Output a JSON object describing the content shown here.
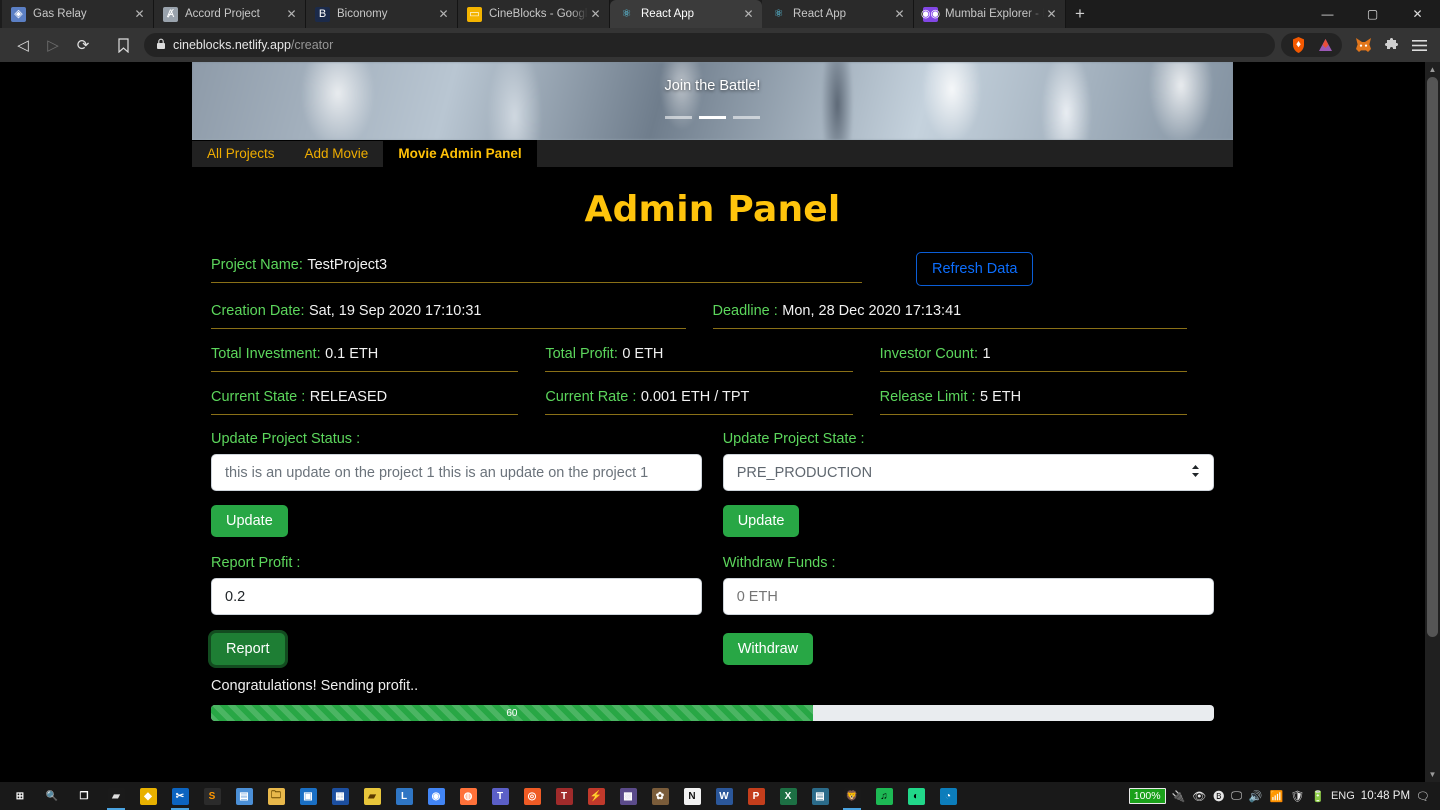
{
  "browser": {
    "tabs": [
      {
        "title": "Gas Relay",
        "icon": "ethereum-gas-icon",
        "glyph": "◈",
        "color": "#5b7fc4",
        "active": false
      },
      {
        "title": "Accord Project",
        "icon": "accord-icon",
        "glyph": "Ⱥ",
        "color": "#9aa3ad",
        "active": false
      },
      {
        "title": "Biconomy",
        "icon": "biconomy-icon",
        "glyph": "B",
        "color": "#1b2a4a",
        "active": false
      },
      {
        "title": "CineBlocks - Google Slid",
        "icon": "google-slides-icon",
        "glyph": "▭",
        "color": "#f4b400",
        "active": false
      },
      {
        "title": "React App",
        "icon": "react-icon",
        "glyph": "⚛",
        "color": "#61dafb",
        "active": true
      },
      {
        "title": "React App",
        "icon": "react-icon",
        "glyph": "⚛",
        "color": "#61dafb",
        "active": false
      },
      {
        "title": "Mumbai Explorer - Block",
        "icon": "polygon-explorer-icon",
        "glyph": "◉◉",
        "color": "#8247e5",
        "active": false
      }
    ],
    "close_label": "✕",
    "new_tab_label": "+",
    "window_controls": {
      "minimize": "—",
      "maximize": "▢",
      "close": "✕"
    },
    "nav": {
      "back": "◁",
      "forward": "▷",
      "reload": "⟳",
      "bookmark": "🔖"
    },
    "url": {
      "lock": "🔒",
      "host": "cineblocks.netlify.app",
      "path": "/creator"
    },
    "right_icons": [
      {
        "name": "brave-shields-icon",
        "glyph": "🦁"
      },
      {
        "name": "brave-rewards-icon",
        "glyph": "🔺"
      },
      {
        "name": "metamask-extension-icon",
        "glyph": "🦊"
      },
      {
        "name": "extensions-icon",
        "glyph": "🧩"
      },
      {
        "name": "browser-menu-icon",
        "glyph": "☰"
      }
    ]
  },
  "carousel": {
    "caption": "Join the Battle!",
    "slides": 3,
    "active_slide": 2
  },
  "nav_tabs": [
    {
      "label": "All Projects",
      "active": false
    },
    {
      "label": "Add Movie",
      "active": false
    },
    {
      "label": "Movie Admin Panel",
      "active": true
    }
  ],
  "panel": {
    "title": "Admin Panel",
    "refresh_button": "Refresh Data",
    "info": {
      "project_name": {
        "label": "Project Name:",
        "value": "TestProject3"
      },
      "creation_date": {
        "label": "Creation Date:",
        "value": "Sat, 19 Sep 2020 17:10:31"
      },
      "deadline": {
        "label": "Deadline :",
        "value": "Mon, 28 Dec 2020 17:13:41"
      },
      "total_investment": {
        "label": "Total Investment:",
        "value": "0.1 ETH"
      },
      "total_profit": {
        "label": "Total Profit:",
        "value": "0 ETH"
      },
      "investor_count": {
        "label": "Investor Count:",
        "value": "1"
      },
      "current_state": {
        "label": "Current State :",
        "value": "RELEASED"
      },
      "current_rate": {
        "label": "Current Rate :",
        "value": "0.001 ETH / TPT"
      },
      "release_limit": {
        "label": "Release Limit :",
        "value": "5 ETH"
      }
    },
    "forms": {
      "update_status": {
        "label": "Update Project Status :",
        "value": "this is an update on the project 1 this is an update on the project 1",
        "placeholder": "this is an update on the project 1 this is an update on the project 1",
        "button": "Update"
      },
      "update_state": {
        "label": "Update Project State :",
        "selected": "PRE_PRODUCTION",
        "button": "Update",
        "chevron": "⇕"
      },
      "report_profit": {
        "label": "Report Profit :",
        "value": "0.2",
        "placeholder": "0.2",
        "button": "Report"
      },
      "withdraw_funds": {
        "label": "Withdraw Funds :",
        "value": "",
        "placeholder": "0 ETH",
        "button": "Withdraw"
      }
    },
    "status_message": "Congratulations! Sending profit..",
    "progress": {
      "percent": 60,
      "label": "60"
    }
  },
  "colors": {
    "accent_gold": "#ffc40c",
    "label_green": "#5cd65c",
    "button_green": "#28a745",
    "link_blue": "#0d6efd",
    "underline": "#8a7017"
  },
  "taskbar": {
    "items": [
      {
        "name": "start-button",
        "glyph": "⊞",
        "color": "transparent",
        "text": "#fff",
        "running": false
      },
      {
        "name": "search-icon",
        "glyph": "🔍",
        "color": "transparent",
        "text": "#fff",
        "running": false
      },
      {
        "name": "task-view-icon",
        "glyph": "❐",
        "color": "transparent",
        "text": "#fff",
        "running": false
      },
      {
        "name": "terminal-icon",
        "glyph": "▰",
        "color": "#1a1a1a",
        "text": "#ddd",
        "running": true
      },
      {
        "name": "paint-net-icon",
        "glyph": "◆",
        "color": "#e8b100",
        "text": "#fff",
        "running": false
      },
      {
        "name": "vscode-icon",
        "glyph": "✂",
        "color": "#0c64c0",
        "text": "#fff",
        "running": true
      },
      {
        "name": "sublime-text-icon",
        "glyph": "S",
        "color": "#2b2b2b",
        "text": "#ff9800",
        "running": false
      },
      {
        "name": "notes-icon",
        "glyph": "▤",
        "color": "#4b8fd6",
        "text": "#fff",
        "running": false
      },
      {
        "name": "file-explorer-icon",
        "glyph": "🗀",
        "color": "#e8b84b",
        "text": "#6b4b00",
        "running": false
      },
      {
        "name": "outlook-icon",
        "glyph": "▣",
        "color": "#1a6fc4",
        "text": "#fff",
        "running": false
      },
      {
        "name": "devtools-icon",
        "glyph": "▦",
        "color": "#1c4fa0",
        "text": "#fff",
        "running": false
      },
      {
        "name": "pdf-reader-icon",
        "glyph": "▰",
        "color": "#e8c63b",
        "text": "#5a3a00",
        "running": false
      },
      {
        "name": "lastpass-icon",
        "glyph": "L",
        "color": "#2f76c4",
        "text": "#fff",
        "running": false
      },
      {
        "name": "chrome-icon",
        "glyph": "◉",
        "color": "#4285f4",
        "text": "#fff",
        "running": false
      },
      {
        "name": "firefox-icon",
        "glyph": "◍",
        "color": "#ff7139",
        "text": "#fff",
        "running": false
      },
      {
        "name": "teams-icon",
        "glyph": "T",
        "color": "#5b5fc7",
        "text": "#fff",
        "running": false
      },
      {
        "name": "postman-icon",
        "glyph": "◎",
        "color": "#ef5b25",
        "text": "#fff",
        "running": false
      },
      {
        "name": "truffle-icon",
        "glyph": "T",
        "color": "#a02b2b",
        "text": "#fff",
        "running": false
      },
      {
        "name": "remix-icon",
        "glyph": "⚡",
        "color": "#c0392b",
        "text": "#fff",
        "running": false
      },
      {
        "name": "ganache-icon",
        "glyph": "▩",
        "color": "#5b4b8a",
        "text": "#fff",
        "running": false
      },
      {
        "name": "gimp-icon",
        "glyph": "✿",
        "color": "#7a5c3a",
        "text": "#fff",
        "running": false
      },
      {
        "name": "notion-icon",
        "glyph": "N",
        "color": "#f2f2f2",
        "text": "#111",
        "running": false
      },
      {
        "name": "word-icon",
        "glyph": "W",
        "color": "#2b579a",
        "text": "#fff",
        "running": false
      },
      {
        "name": "powerpoint-icon",
        "glyph": "P",
        "color": "#c43e1c",
        "text": "#fff",
        "running": false
      },
      {
        "name": "excel-icon",
        "glyph": "X",
        "color": "#1d7044",
        "text": "#fff",
        "running": false
      },
      {
        "name": "mysql-icon",
        "glyph": "▤",
        "color": "#2b6b8a",
        "text": "#fff",
        "running": false
      },
      {
        "name": "brave-browser-icon",
        "glyph": "🦁",
        "color": "#1a1a1a",
        "text": "#f35800",
        "running": true
      },
      {
        "name": "spotify-icon",
        "glyph": "♫",
        "color": "#1db954",
        "text": "#000",
        "running": false
      },
      {
        "name": "pycharm-icon",
        "glyph": "◐",
        "color": "#21d789",
        "text": "#000",
        "running": false
      },
      {
        "name": "edge-icon",
        "glyph": "◔",
        "color": "#0c7dbb",
        "text": "#fff",
        "running": false
      }
    ],
    "tray": {
      "battery_percent": "100%",
      "icons": [
        {
          "name": "power-plug-icon",
          "glyph": "🔌"
        },
        {
          "name": "nvidia-icon",
          "glyph": "👁"
        },
        {
          "name": "bluetooth-icon",
          "glyph": "🅑"
        },
        {
          "name": "display-icon",
          "glyph": "🖵"
        },
        {
          "name": "volume-icon",
          "glyph": "🔊"
        },
        {
          "name": "wifi-icon",
          "glyph": "📶"
        },
        {
          "name": "security-shield-icon",
          "glyph": "🛡"
        },
        {
          "name": "battery-icon",
          "glyph": "🔋"
        }
      ],
      "language": "ENG",
      "clock": "10:48 PM",
      "action_center": "🗨"
    }
  }
}
